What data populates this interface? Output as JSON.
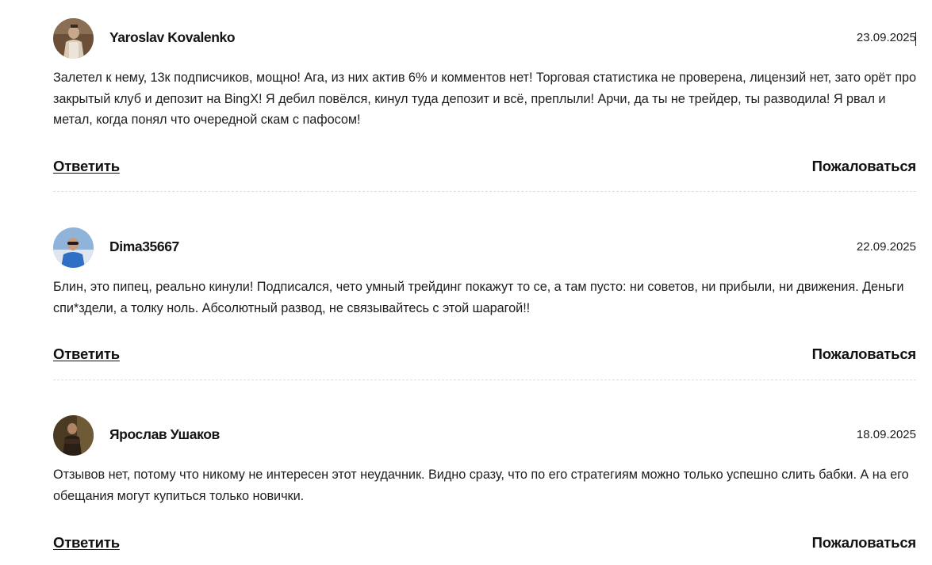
{
  "comments": [
    {
      "author": "Yaroslav Kovalenko",
      "date": "23.09.2025",
      "text": "Залетел к нему, 13к подписчиков, мощно! Ага, из них актив 6% и комментов нет! Торговая статистика не проверена, лицензий нет, зато орёт про закрытый клуб и депозит на BingX! Я дебил повёлся, кинул туда депозит и всё, преплыли! Арчи, да ты не трейдер, ты разводила! Я рвал и метал, когда понял что очередной скам с пафосом!",
      "reply_label": "Ответить",
      "report_label": "Пожаловаться"
    },
    {
      "author": "Dima35667",
      "date": "22.09.2025",
      "text": "Блин, это пипец, реально кинули! Подписался, чето умный трейдинг покажут то се, а там пусто: ни советов, ни прибыли, ни движения. Деньги спи*здели, а толку ноль. Абсолютный развод, не связывайтесь с этой шарагой!!",
      "reply_label": "Ответить",
      "report_label": "Пожаловаться"
    },
    {
      "author": "Ярослав Ушаков",
      "date": "18.09.2025",
      "text": "Отзывов нет, потому что никому не интересен этот неудачник. Видно сразу, что по его стратегиям можно только успешно слить бабки. А на его обещания могут купиться только новички.",
      "reply_label": "Ответить",
      "report_label": "Пожаловаться"
    }
  ],
  "colors": {
    "text": "#1e1e1e",
    "divider": "#dcdcdc",
    "background": "#ffffff"
  }
}
